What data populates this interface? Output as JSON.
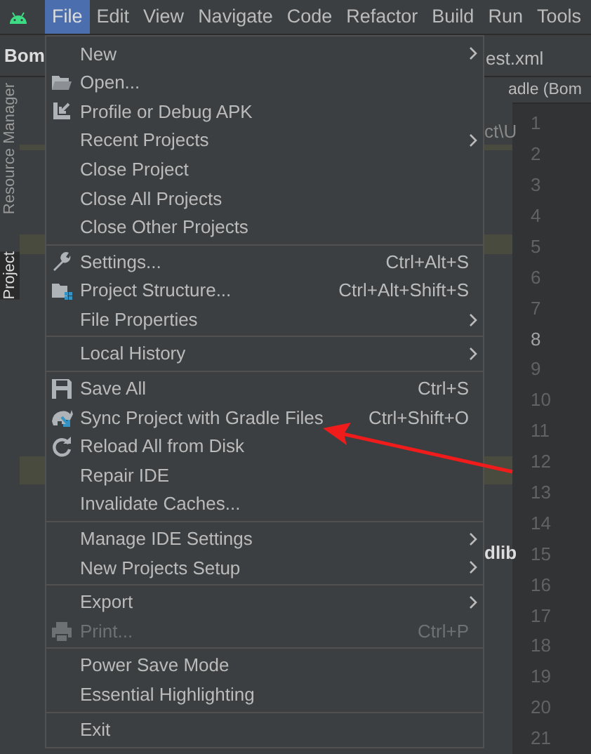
{
  "menu_bar": [
    {
      "label": "File",
      "selected": true
    },
    {
      "label": "Edit",
      "selected": false
    },
    {
      "label": "View",
      "selected": false
    },
    {
      "label": "Navigate",
      "selected": false
    },
    {
      "label": "Code",
      "selected": false
    },
    {
      "label": "Refactor",
      "selected": false
    },
    {
      "label": "Build",
      "selected": false
    },
    {
      "label": "Run",
      "selected": false
    },
    {
      "label": "Tools",
      "selected": false
    }
  ],
  "background": {
    "tab_left": "Bom",
    "tab_right": "est.xml",
    "panel_title": "adle (Bom",
    "path_fragment": "ct\\U",
    "tree_fragment": "dlib",
    "side_tabs": [
      "Resource Manager",
      "Project"
    ],
    "line_numbers": [
      {
        "label": "1",
        "current": false
      },
      {
        "label": "2",
        "current": false
      },
      {
        "label": "3",
        "current": false
      },
      {
        "label": "4",
        "current": false
      },
      {
        "label": "5",
        "current": false
      },
      {
        "label": "6",
        "current": false
      },
      {
        "label": "7",
        "current": false
      },
      {
        "label": "8",
        "current": true
      },
      {
        "label": "9",
        "current": false
      },
      {
        "label": "10",
        "current": false
      },
      {
        "label": "11",
        "current": false
      },
      {
        "label": "12",
        "current": false
      },
      {
        "label": "13",
        "current": false
      },
      {
        "label": "14",
        "current": false
      },
      {
        "label": "15",
        "current": false
      },
      {
        "label": "16",
        "current": false
      },
      {
        "label": "17",
        "current": false
      },
      {
        "label": "18",
        "current": false
      },
      {
        "label": "19",
        "current": false
      },
      {
        "label": "20",
        "current": false
      },
      {
        "label": "21",
        "current": false
      }
    ]
  },
  "file_menu": [
    [
      {
        "label": "New",
        "submenu": true,
        "disabled": false
      },
      {
        "label": "Open...",
        "submenu": false,
        "disabled": false
      },
      {
        "label": "Profile or Debug APK",
        "submenu": false,
        "disabled": false
      },
      {
        "label": "Recent Projects",
        "submenu": true,
        "disabled": false
      },
      {
        "label": "Close Project",
        "submenu": false,
        "disabled": false
      },
      {
        "label": "Close All Projects",
        "submenu": false,
        "disabled": false
      },
      {
        "label": "Close Other Projects",
        "submenu": false,
        "disabled": false
      }
    ],
    [
      {
        "label": "Settings...",
        "shortcut": "Ctrl+Alt+S",
        "submenu": false,
        "disabled": false
      },
      {
        "label": "Project Structure...",
        "shortcut": "Ctrl+Alt+Shift+S",
        "submenu": false,
        "disabled": false
      },
      {
        "label": "File Properties",
        "submenu": true,
        "disabled": false
      }
    ],
    [
      {
        "label": "Local History",
        "submenu": true,
        "disabled": false
      }
    ],
    [
      {
        "label": "Save All",
        "shortcut": "Ctrl+S",
        "submenu": false,
        "disabled": false
      },
      {
        "label": "Sync Project with Gradle Files",
        "shortcut": "Ctrl+Shift+O",
        "submenu": false,
        "disabled": false
      },
      {
        "label": "Reload All from Disk",
        "submenu": false,
        "disabled": false
      },
      {
        "label": "Repair IDE",
        "submenu": false,
        "disabled": false
      },
      {
        "label": "Invalidate Caches...",
        "submenu": false,
        "disabled": false
      }
    ],
    [
      {
        "label": "Manage IDE Settings",
        "submenu": true,
        "disabled": false
      },
      {
        "label": "New Projects Setup",
        "submenu": true,
        "disabled": false
      }
    ],
    [
      {
        "label": "Export",
        "submenu": true,
        "disabled": false
      },
      {
        "label": "Print...",
        "shortcut": "Ctrl+P",
        "submenu": false,
        "disabled": true
      }
    ],
    [
      {
        "label": "Power Save Mode",
        "submenu": false,
        "disabled": false
      },
      {
        "label": "Essential Highlighting",
        "submenu": false,
        "disabled": false
      }
    ],
    [
      {
        "label": "Exit",
        "submenu": false,
        "disabled": false
      }
    ]
  ]
}
